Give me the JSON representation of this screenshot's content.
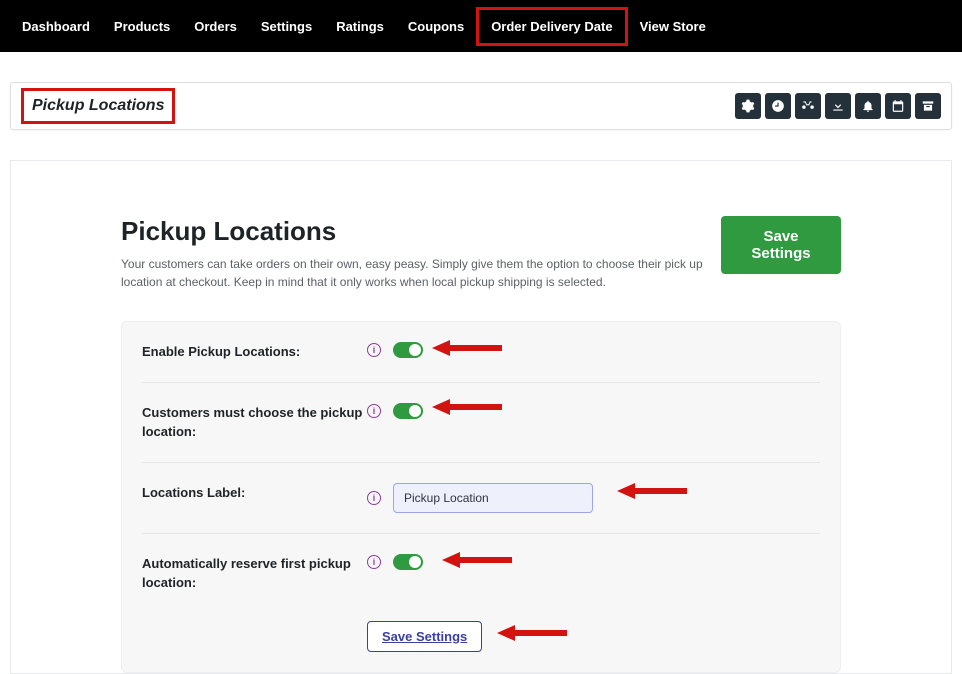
{
  "nav": {
    "items": [
      "Dashboard",
      "Products",
      "Orders",
      "Settings",
      "Ratings",
      "Coupons",
      "Order Delivery Date",
      "View Store"
    ],
    "highlighted_index": 6
  },
  "pagebar": {
    "title": "Pickup Locations",
    "icons": [
      "gear-icon",
      "clock-icon",
      "bike-icon",
      "download-icon",
      "bell-icon",
      "calendar-icon",
      "archive-icon"
    ]
  },
  "content": {
    "heading": "Pickup Locations",
    "subtext": "Your customers can take orders on their own, easy peasy. Simply give them the option to choose their pick up location at checkout. Keep in mind that it only works when local pickup shipping is selected.",
    "save_button": "Save Settings"
  },
  "settings": {
    "rows": [
      {
        "label": "Enable Pickup Locations:",
        "type": "toggle",
        "value": true
      },
      {
        "label": "Customers must choose the pickup location:",
        "type": "toggle",
        "value": true
      },
      {
        "label": "Locations Label:",
        "type": "text",
        "value": "Pickup Location"
      },
      {
        "label": "Automatically reserve first pickup location:",
        "type": "toggle",
        "value": true
      }
    ],
    "save_button_small": "Save Settings"
  },
  "annotation_color": "#d31310"
}
